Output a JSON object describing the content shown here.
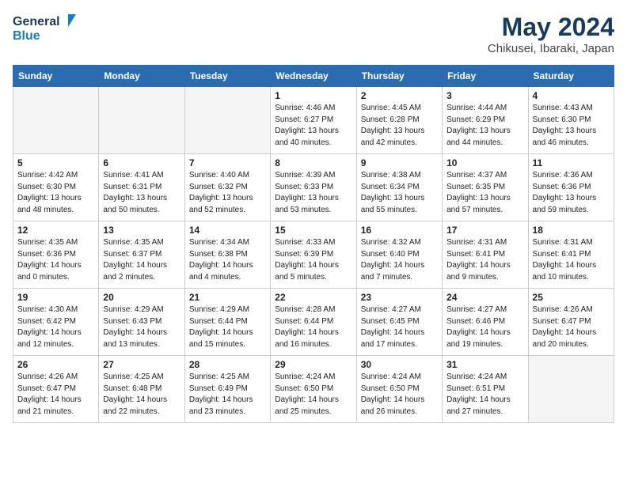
{
  "logo": {
    "line1": "General",
    "line2": "Blue"
  },
  "title": "May 2024",
  "location": "Chikusei, Ibaraki, Japan",
  "days_header": [
    "Sunday",
    "Monday",
    "Tuesday",
    "Wednesday",
    "Thursday",
    "Friday",
    "Saturday"
  ],
  "weeks": [
    [
      {
        "day": "",
        "info": ""
      },
      {
        "day": "",
        "info": ""
      },
      {
        "day": "",
        "info": ""
      },
      {
        "day": "1",
        "info": "Sunrise: 4:46 AM\nSunset: 6:27 PM\nDaylight: 13 hours\nand 40 minutes."
      },
      {
        "day": "2",
        "info": "Sunrise: 4:45 AM\nSunset: 6:28 PM\nDaylight: 13 hours\nand 42 minutes."
      },
      {
        "day": "3",
        "info": "Sunrise: 4:44 AM\nSunset: 6:29 PM\nDaylight: 13 hours\nand 44 minutes."
      },
      {
        "day": "4",
        "info": "Sunrise: 4:43 AM\nSunset: 6:30 PM\nDaylight: 13 hours\nand 46 minutes."
      }
    ],
    [
      {
        "day": "5",
        "info": "Sunrise: 4:42 AM\nSunset: 6:30 PM\nDaylight: 13 hours\nand 48 minutes."
      },
      {
        "day": "6",
        "info": "Sunrise: 4:41 AM\nSunset: 6:31 PM\nDaylight: 13 hours\nand 50 minutes."
      },
      {
        "day": "7",
        "info": "Sunrise: 4:40 AM\nSunset: 6:32 PM\nDaylight: 13 hours\nand 52 minutes."
      },
      {
        "day": "8",
        "info": "Sunrise: 4:39 AM\nSunset: 6:33 PM\nDaylight: 13 hours\nand 53 minutes."
      },
      {
        "day": "9",
        "info": "Sunrise: 4:38 AM\nSunset: 6:34 PM\nDaylight: 13 hours\nand 55 minutes."
      },
      {
        "day": "10",
        "info": "Sunrise: 4:37 AM\nSunset: 6:35 PM\nDaylight: 13 hours\nand 57 minutes."
      },
      {
        "day": "11",
        "info": "Sunrise: 4:36 AM\nSunset: 6:36 PM\nDaylight: 13 hours\nand 59 minutes."
      }
    ],
    [
      {
        "day": "12",
        "info": "Sunrise: 4:35 AM\nSunset: 6:36 PM\nDaylight: 14 hours\nand 0 minutes."
      },
      {
        "day": "13",
        "info": "Sunrise: 4:35 AM\nSunset: 6:37 PM\nDaylight: 14 hours\nand 2 minutes."
      },
      {
        "day": "14",
        "info": "Sunrise: 4:34 AM\nSunset: 6:38 PM\nDaylight: 14 hours\nand 4 minutes."
      },
      {
        "day": "15",
        "info": "Sunrise: 4:33 AM\nSunset: 6:39 PM\nDaylight: 14 hours\nand 5 minutes."
      },
      {
        "day": "16",
        "info": "Sunrise: 4:32 AM\nSunset: 6:40 PM\nDaylight: 14 hours\nand 7 minutes."
      },
      {
        "day": "17",
        "info": "Sunrise: 4:31 AM\nSunset: 6:41 PM\nDaylight: 14 hours\nand 9 minutes."
      },
      {
        "day": "18",
        "info": "Sunrise: 4:31 AM\nSunset: 6:41 PM\nDaylight: 14 hours\nand 10 minutes."
      }
    ],
    [
      {
        "day": "19",
        "info": "Sunrise: 4:30 AM\nSunset: 6:42 PM\nDaylight: 14 hours\nand 12 minutes."
      },
      {
        "day": "20",
        "info": "Sunrise: 4:29 AM\nSunset: 6:43 PM\nDaylight: 14 hours\nand 13 minutes."
      },
      {
        "day": "21",
        "info": "Sunrise: 4:29 AM\nSunset: 6:44 PM\nDaylight: 14 hours\nand 15 minutes."
      },
      {
        "day": "22",
        "info": "Sunrise: 4:28 AM\nSunset: 6:44 PM\nDaylight: 14 hours\nand 16 minutes."
      },
      {
        "day": "23",
        "info": "Sunrise: 4:27 AM\nSunset: 6:45 PM\nDaylight: 14 hours\nand 17 minutes."
      },
      {
        "day": "24",
        "info": "Sunrise: 4:27 AM\nSunset: 6:46 PM\nDaylight: 14 hours\nand 19 minutes."
      },
      {
        "day": "25",
        "info": "Sunrise: 4:26 AM\nSunset: 6:47 PM\nDaylight: 14 hours\nand 20 minutes."
      }
    ],
    [
      {
        "day": "26",
        "info": "Sunrise: 4:26 AM\nSunset: 6:47 PM\nDaylight: 14 hours\nand 21 minutes."
      },
      {
        "day": "27",
        "info": "Sunrise: 4:25 AM\nSunset: 6:48 PM\nDaylight: 14 hours\nand 22 minutes."
      },
      {
        "day": "28",
        "info": "Sunrise: 4:25 AM\nSunset: 6:49 PM\nDaylight: 14 hours\nand 23 minutes."
      },
      {
        "day": "29",
        "info": "Sunrise: 4:24 AM\nSunset: 6:50 PM\nDaylight: 14 hours\nand 25 minutes."
      },
      {
        "day": "30",
        "info": "Sunrise: 4:24 AM\nSunset: 6:50 PM\nDaylight: 14 hours\nand 26 minutes."
      },
      {
        "day": "31",
        "info": "Sunrise: 4:24 AM\nSunset: 6:51 PM\nDaylight: 14 hours\nand 27 minutes."
      },
      {
        "day": "",
        "info": ""
      }
    ]
  ]
}
